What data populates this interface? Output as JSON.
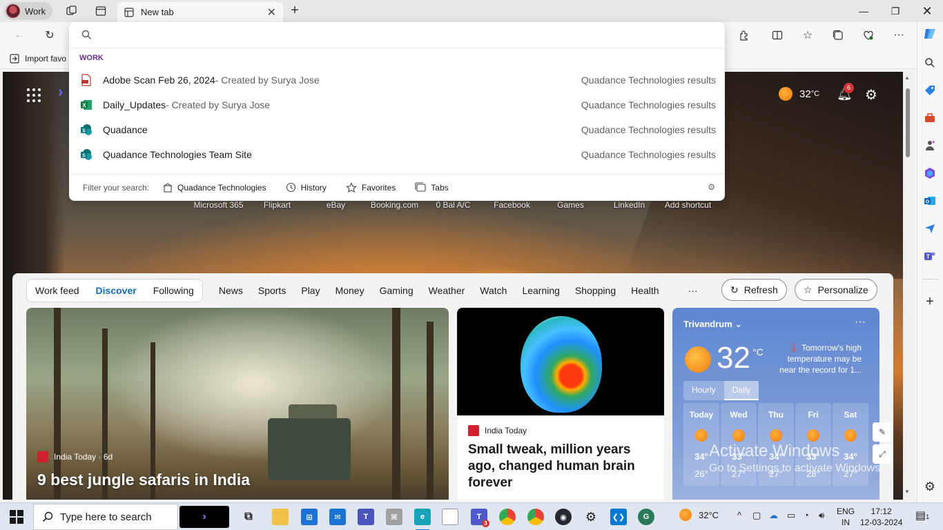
{
  "browser": {
    "profile_label": "Work",
    "tab_title": "New tab",
    "favorites_import_label": "Import favo"
  },
  "omnibox": {
    "input_value": "",
    "section_label": "WORK",
    "results": [
      {
        "title": "Adobe Scan Feb 26, 2024",
        "subtitle": " - Created by Surya Jose",
        "source": "Quadance Technologies results",
        "icon": "pdf-file-icon"
      },
      {
        "title": "Daily_Updates",
        "subtitle": " - Created by Surya Jose",
        "source": "Quadance Technologies results",
        "icon": "excel-file-icon"
      },
      {
        "title": "Quadance",
        "subtitle": "",
        "source": "Quadance Technologies results",
        "icon": "sharepoint-icon"
      },
      {
        "title": "Quadance Technologies Team Site",
        "subtitle": "",
        "source": "Quadance Technologies results",
        "icon": "sharepoint-icon"
      }
    ],
    "filter_label": "Filter your search:",
    "filters": [
      "Quadance Technologies",
      "History",
      "Favorites",
      "Tabs"
    ]
  },
  "newtab": {
    "weather_temp": "32",
    "weather_unit": "°C",
    "notification_count": "6",
    "shortcuts": [
      "Microsoft 365",
      "Flipkart",
      "eBay",
      "Booking.com",
      "0 Bal A/C",
      "Facebook",
      "Games",
      "LinkedIn",
      "Add shortcut"
    ]
  },
  "feed": {
    "primary_tabs": [
      "Work feed",
      "Discover",
      "Following"
    ],
    "active_tab": "Discover",
    "categories": [
      "News",
      "Sports",
      "Play",
      "Money",
      "Gaming",
      "Weather",
      "Watch",
      "Learning",
      "Shopping",
      "Health"
    ],
    "more_label": "···",
    "refresh_label": "Refresh",
    "personalize_label": "Personalize"
  },
  "cards": {
    "big": {
      "source": "India Today · 6d",
      "headline": "9 best jungle safaris in India"
    },
    "mid": {
      "source": "India Today",
      "headline": "Small tweak, million years ago, changed human brain forever"
    }
  },
  "weather_card": {
    "city": "Trivandrum",
    "temp": "32",
    "unit": "°C",
    "note": "Tomorrow's high temperature may be near the record for 1...",
    "tabs": [
      "Hourly",
      "Daily"
    ],
    "days": [
      {
        "name": "Today",
        "hi": "34°",
        "lo": "26°"
      },
      {
        "name": "Wed",
        "hi": "33°",
        "lo": "27°"
      },
      {
        "name": "Thu",
        "hi": "34°",
        "lo": "27°"
      },
      {
        "name": "Fri",
        "hi": "33°",
        "lo": "28°"
      },
      {
        "name": "Sat",
        "hi": "34°",
        "lo": "27°"
      }
    ]
  },
  "watermark": {
    "line1": "Activate Windows",
    "line2": "Go to Settings to activate Windows."
  },
  "taskbar": {
    "search_placeholder": "Type here to search",
    "weather": "32°C",
    "lang_line1": "ENG",
    "lang_line2": "IN",
    "time": "17:12",
    "date": "12-03-2024",
    "teams_badge": "3",
    "notif_badge": "1"
  },
  "colors": {
    "accent": "#0f6cbd",
    "work_label": "#6b2c91",
    "badge": "#d13438"
  }
}
